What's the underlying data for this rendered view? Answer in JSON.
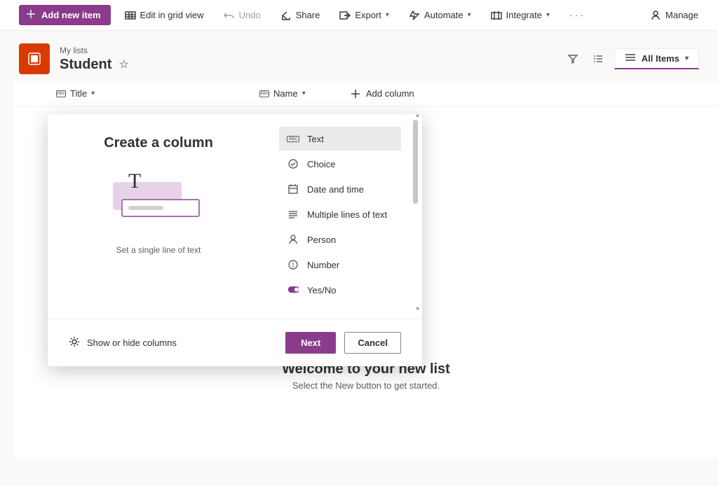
{
  "commandBar": {
    "addNew": "Add new item",
    "editGrid": "Edit in grid view",
    "undo": "Undo",
    "share": "Share",
    "export": "Export",
    "automate": "Automate",
    "integrate": "Integrate",
    "manage": "Manage"
  },
  "list": {
    "breadcrumb": "My lists",
    "title": "Student",
    "viewName": "All Items"
  },
  "columns": {
    "title": "Title",
    "name": "Name",
    "add": "Add column"
  },
  "popup": {
    "heading": "Create a column",
    "description": "Set a single line of text",
    "types": [
      {
        "id": "text",
        "label": "Text",
        "icon": "abc",
        "selected": true
      },
      {
        "id": "choice",
        "label": "Choice",
        "icon": "choice",
        "selected": false
      },
      {
        "id": "datetime",
        "label": "Date and time",
        "icon": "calendar",
        "selected": false
      },
      {
        "id": "multiline",
        "label": "Multiple lines of text",
        "icon": "lines",
        "selected": false
      },
      {
        "id": "person",
        "label": "Person",
        "icon": "person",
        "selected": false
      },
      {
        "id": "number",
        "label": "Number",
        "icon": "number",
        "selected": false
      },
      {
        "id": "yesno",
        "label": "Yes/No",
        "icon": "toggle",
        "selected": false
      }
    ],
    "footerLink": "Show or hide columns",
    "next": "Next",
    "cancel": "Cancel"
  },
  "welcome": {
    "title": "Welcome to your new list",
    "subtitle": "Select the New button to get started."
  }
}
